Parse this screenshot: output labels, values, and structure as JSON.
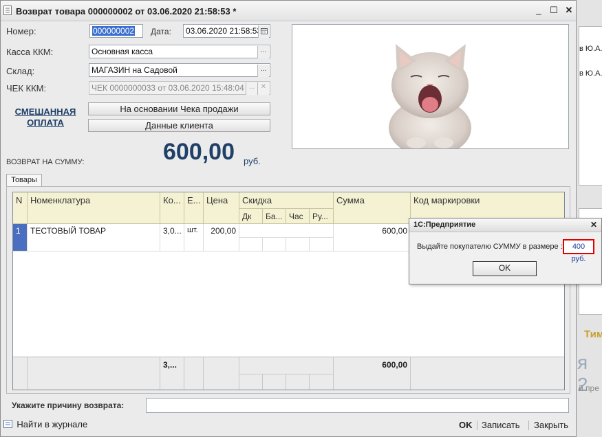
{
  "window": {
    "title": "Возврат товара 000000002 от 03.06.2020 21:58:53 *",
    "min_glyph": "_",
    "max_glyph": "☐",
    "close_glyph": "✕"
  },
  "form": {
    "number_label": "Номер:",
    "number_value": "000000002",
    "date_label": "Дата:",
    "date_value": "03.06.2020 21:58:53",
    "kassa_label": "Касса ККМ:",
    "kassa_value": "Основная касса",
    "sklad_label": "Склад:",
    "sklad_value": "МАГАЗИН на Садовой",
    "check_label": "ЧЕК ККМ:",
    "check_value": "ЧЕК 0000000033 от 03.06.2020 15:48:04",
    "select_glyph": "...",
    "mixed_payment_line1": "СМЕШАННАЯ",
    "mixed_payment_line2": "ОПЛАТА",
    "btn_based_on_check": "На основании Чека продажи",
    "btn_client_data": "Данные клиента",
    "return_sum_label": "ВОЗВРАТ НА СУММУ:",
    "return_sum_value": "600,00",
    "currency": "руб."
  },
  "tabs": [
    {
      "label": "Товары"
    }
  ],
  "table": {
    "headers": {
      "n": "N",
      "nomenclature": "Номенклатура",
      "qty": "Ко...",
      "unit": "Е...",
      "price": "Цена",
      "discount": "Скидка",
      "sum": "Сумма",
      "marking": "Код маркировки"
    },
    "discount_sub": [
      "Дк",
      "Ба...",
      "Час",
      "Ру..."
    ],
    "rows": [
      {
        "n": "1",
        "name": "ТЕСТОВЫЙ ТОВАР",
        "qty": "3,0...",
        "unit": "шт.",
        "price": "200,00",
        "sum": "600,00",
        "marking": ""
      }
    ],
    "footer": {
      "qty": "3,...",
      "sum": "600,00"
    }
  },
  "reason": {
    "label": "Укажите причину возврата:",
    "value": ""
  },
  "bottom": {
    "journal": "Найти в журнале",
    "ok": "OK",
    "save": "Записать",
    "close": "Закрыть"
  },
  "dialog": {
    "title": "1С:Предприятие",
    "message": "Выдайте покупателю СУММУ в размере :",
    "amount": "400 руб.",
    "ok": "OK",
    "close_glyph": "✕"
  },
  "background_window": {
    "text1": "в Ю.А.",
    "text2": "в Ю.А.",
    "text3": "Тим",
    "text4": "я 2",
    "text5": "й пре"
  },
  "colors": {
    "accent": "#1f4068",
    "grid_header": "#f5f2d3",
    "highlight_box": "#e00000",
    "row_selected": "#4a6fc0"
  },
  "icons": {
    "document": "document-icon",
    "calendar": "calendar-icon",
    "journal": "journal-icon"
  }
}
